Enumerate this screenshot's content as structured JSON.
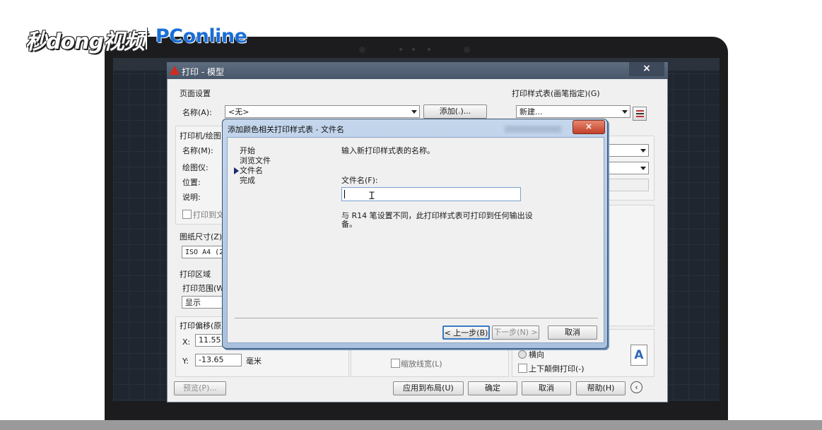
{
  "watermark": {
    "brand1": "秒dong视频",
    "brand2": "PConline"
  },
  "main_dialog": {
    "title": "打印 - 模型",
    "close": "×",
    "page_setup": {
      "section": "页面设置",
      "name_label": "名称(A):",
      "name_value": "<无>",
      "add_button": "添加(.)..."
    },
    "printer": {
      "section": "打印机/绘图",
      "name_label": "名称(M):",
      "plotter_label": "绘图仪:",
      "location_label": "位置:",
      "desc_label": "说明:",
      "print_to_file": "打印到文"
    },
    "paper": {
      "section": "图纸尺寸(Z)",
      "value": "ISO A4 (2"
    },
    "area": {
      "section": "打印区域",
      "range_label": "打印范围(W",
      "range_value": "显示"
    },
    "offset": {
      "section": "打印偏移(原",
      "x_label": "X:",
      "x_value": "11.55",
      "y_label": "Y:",
      "y_value": "-13.65",
      "unit": "毫米"
    },
    "style_table": {
      "section": "打印样式表(画笔指定)(G)",
      "value": "新建..."
    },
    "orientation": {
      "landscape": "横向",
      "upside_down": "上下颠倒打印(-)"
    },
    "scale_lineweights": "缩放线宽(L)",
    "preview_icon_letter": "A",
    "buttons": {
      "preview": "预览(P)...",
      "apply_layout": "应用到布局(U)",
      "ok": "确定",
      "cancel": "取消",
      "help": "帮助(H)"
    },
    "expand_icon": "‹"
  },
  "sub_dialog": {
    "title": "添加颜色相关打印样式表 - 文件名",
    "close": "×",
    "steps": [
      "开始",
      "浏览文件",
      "文件名",
      "完成"
    ],
    "instruction": "输入新打印样式表的名称。",
    "filename_label": "文件名(F):",
    "filename_value": "",
    "note_line1": "与 R14 笔设置不同，此打印样式表可打印到任何输出设",
    "note_line2": "备。",
    "buttons": {
      "back": "< 上一步(B)",
      "next": "下一步(N) >",
      "cancel": "取消"
    }
  }
}
